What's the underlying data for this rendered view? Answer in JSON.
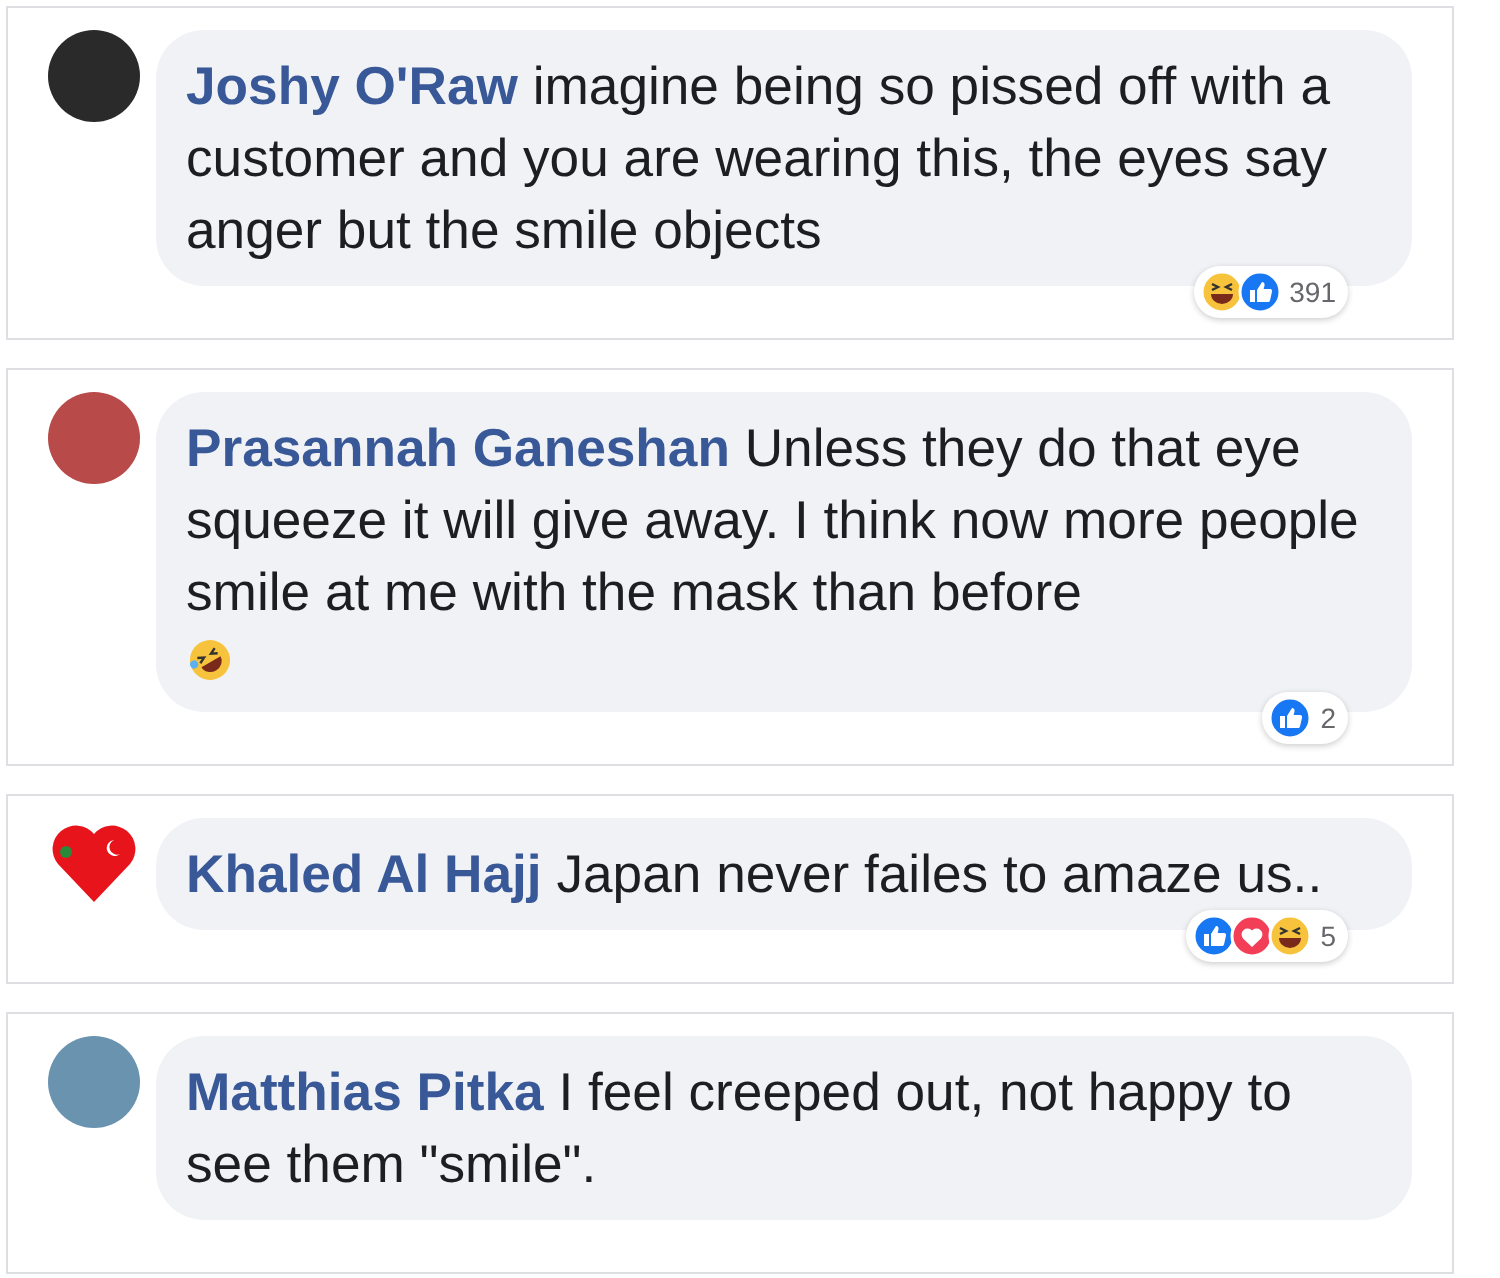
{
  "comments": [
    {
      "author": "Joshy O'Raw",
      "avatar": {
        "kind": "photo"
      },
      "text": "imagine being so pissed off with a customer and you are wearing this, the eyes say anger but the smile objects",
      "emoji_line": false,
      "reactions": [
        {
          "kind": "haha"
        },
        {
          "kind": "like"
        }
      ],
      "count": "391"
    },
    {
      "author": "Prasannah Ganeshan",
      "avatar": {
        "kind": "photo"
      },
      "text": "Unless they do that eye squeeze it will give away. I think now more people smile at me with the mask than before",
      "emoji_line": true,
      "reactions": [
        {
          "kind": "like"
        }
      ],
      "count": "2"
    },
    {
      "author": "Khaled Al Hajj",
      "avatar": {
        "kind": "heart"
      },
      "text": "Japan never failes to amaze us..",
      "emoji_line": false,
      "reactions": [
        {
          "kind": "like"
        },
        {
          "kind": "love"
        },
        {
          "kind": "haha"
        }
      ],
      "count": "5"
    },
    {
      "author": "Matthias Pitka",
      "avatar": {
        "kind": "photo"
      },
      "text": "I feel creeped out, not happy to see them \"smile\".",
      "emoji_line": false
    }
  ]
}
